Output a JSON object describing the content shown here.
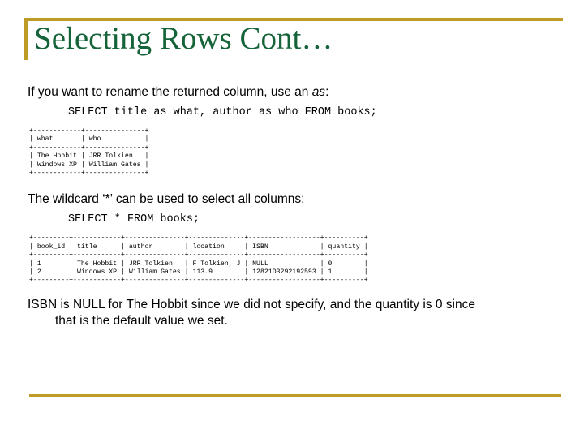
{
  "slide": {
    "title": "Selecting Rows Cont…",
    "accent_gold": "#bd9b26",
    "title_green": "#156338"
  },
  "section_alias": {
    "intro_before": "If you want to rename the returned column, use an ",
    "intro_keyword": "as",
    "intro_after": ":",
    "sql": "SELECT title as what, author as who FROM books;",
    "result_table": "+------------+---------------+\n| what       | who           |\n+------------+---------------+\n| The Hobbit | JRR Tolkien   |\n| Windows XP | William Gates |\n+------------+---------------+"
  },
  "section_wildcard": {
    "intro": "The wildcard ‘*’ can be used to select all columns:",
    "sql": "SELECT * FROM books;",
    "result_table": "+---------+------------+---------------+--------------+------------------+----------+\n| book_id | title      | author        | location     | ISBN             | quantity |\n+---------+------------+---------------+--------------+------------------+----------+\n| 1       | The Hobbit | JRR Tolkien   | F Tolkien, J | NULL             | 0        |\n| 2       | Windows XP | William Gates | 113.9        | 12821D3292192593 | 1        |\n+---------+------------+---------------+--------------+------------------+----------+"
  },
  "closing": {
    "line1": "ISBN is NULL for The Hobbit since we did not specify, and the quantity is 0 since",
    "line2": "that is the default value we set."
  }
}
